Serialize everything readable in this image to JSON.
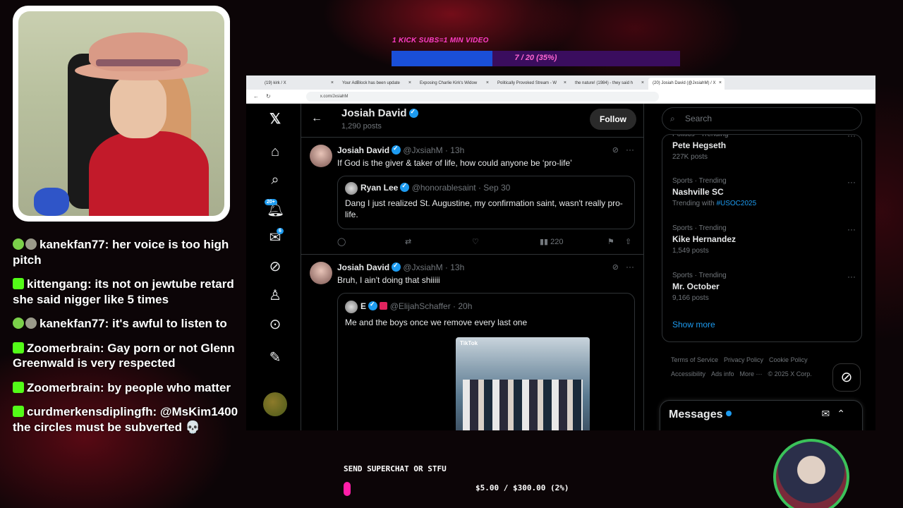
{
  "overlay": {
    "kick_goal_label": "1 KICK SUBS=1 MIN VIDEO",
    "kick_goal_text": "7 / 20 (35%)",
    "kick_goal_progress": 0.35,
    "superchat_label": "SEND SUPERCHAT OR STFU",
    "superchat_text": "$5.00 / $300.00 (2%)",
    "superchat_progress": 0.02
  },
  "chat": [
    {
      "badge": "round",
      "text": "kanekfan77: her voice is too high pitch"
    },
    {
      "badge": "kick",
      "text": "kittengang: its not on jewtube retard she said nigger like 5 times"
    },
    {
      "badge": "round",
      "text": "kanekfan77: it's awful to listen to"
    },
    {
      "badge": "kick",
      "text": "Zoomerbrain: Gay porn or not Glenn Greenwald is very respected"
    },
    {
      "badge": "kick",
      "text": "Zoomerbrain: by people who matter"
    },
    {
      "badge": "kick",
      "text": "curdmerkensdiplingfh: @MsKim1400 the circles must be subverted 💀"
    }
  ],
  "browser": {
    "tabs": [
      "(19) kirk / X",
      "Your AdBlock has been update",
      "Exposing Charlie Kirk's Widow",
      "Politically Provoked Stream - W",
      "the nature! (1984) - they said h",
      "(20) Josiah David (@JxsiahM) / X"
    ],
    "url": "x.com/JxsiahM"
  },
  "nav": {
    "notif_badge": "20+",
    "msg_badge": "6"
  },
  "profile": {
    "name": "Josiah David",
    "posts": "1,290 posts",
    "follow": "Follow"
  },
  "tweets": [
    {
      "name": "Josiah David",
      "handle": "@JxsiahM · 13h",
      "text": "If God is the giver & taker of life, how could anyone be ‘pro-life’",
      "quote_name": "Ryan Lee",
      "quote_handle": "@honorablesaint · Sep 30",
      "quote_text": "Dang I just realized St. Augustine, my confirmation saint, wasn't really pro-life.",
      "views": "220"
    },
    {
      "name": "Josiah David",
      "handle": "@JxsiahM · 13h",
      "text": "Bruh, I ain't doing that shiiiii",
      "quote_name": "E",
      "quote_handle": "@ElijahSchaffer · 20h",
      "quote_text": "Me and the boys once we remove every last one",
      "video_label": "TikTok"
    }
  ],
  "right": {
    "search_placeholder": "Search",
    "trends": [
      {
        "cat": "Politics · Trending",
        "title": "Pete Hegseth",
        "sub": "227K posts"
      },
      {
        "cat": "Sports · Trending",
        "title": "Nashville SC",
        "sub": "Trending with ",
        "tag": "#USOC2025"
      },
      {
        "cat": "Sports · Trending",
        "title": "Kike Hernandez",
        "sub": "1,549 posts"
      },
      {
        "cat": "Sports · Trending",
        "title": "Mr. October",
        "sub": "9,166 posts"
      }
    ],
    "show_more": "Show more",
    "footer": [
      "Terms of Service",
      "Privacy Policy",
      "Cookie Policy",
      "Accessibility",
      "Ads info",
      "More ···",
      "© 2025 X Corp."
    ],
    "messages": "Messages"
  },
  "colors": {
    "accent": "#1d9bf0",
    "kick": "#53fc18",
    "superchat": "#ff1ea8"
  }
}
